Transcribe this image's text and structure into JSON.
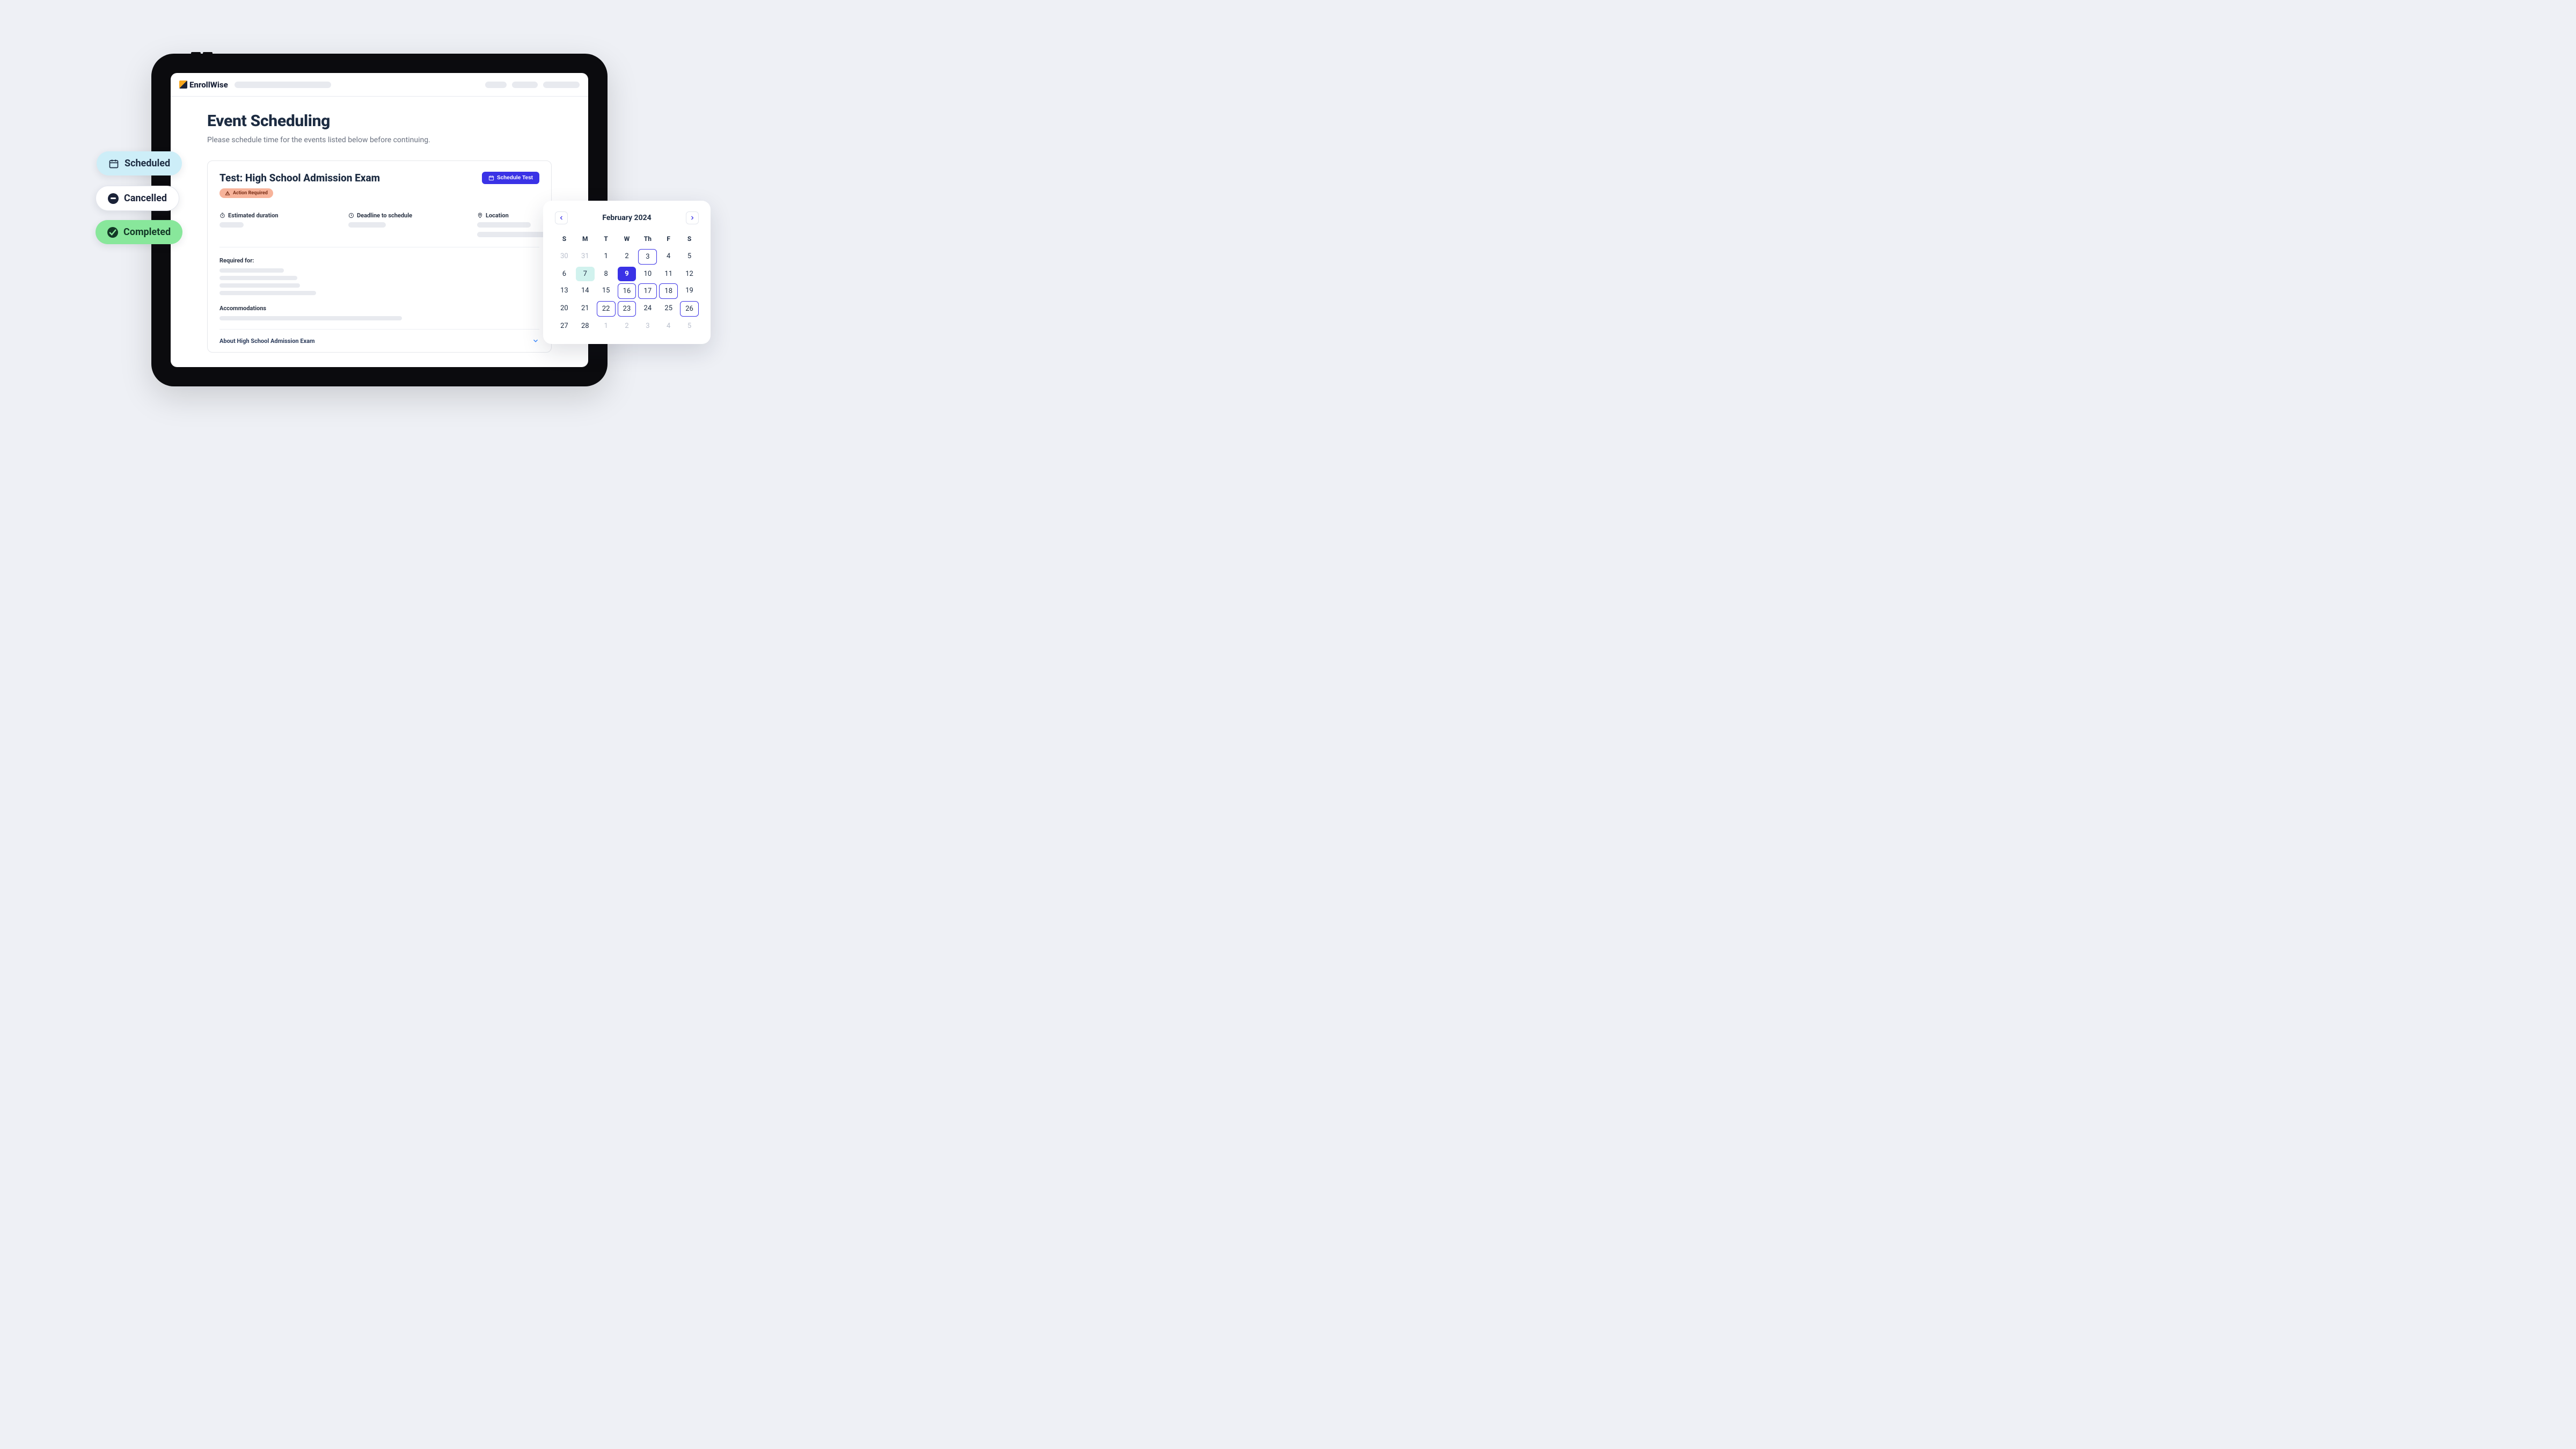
{
  "brand": "EnrollWise",
  "page": {
    "title": "Event Scheduling",
    "subtitle": "Please schedule time for the events listed below before continuing."
  },
  "card": {
    "title": "Test: High School Admission Exam",
    "badge": "Action Required",
    "schedule_button": "Schedule Test",
    "meta": {
      "duration_label": "Estimated duration",
      "deadline_label": "Deadline to schedule",
      "location_label": "Location"
    },
    "section_required": "Required for:",
    "section_accommodations": "Accommodations",
    "about_label": "About High School Admission Exam"
  },
  "status_pills": {
    "scheduled": "Scheduled",
    "cancelled": "Cancelled",
    "completed": "Completed"
  },
  "calendar": {
    "month_label": "February 2024",
    "dow": [
      "S",
      "M",
      "T",
      "W",
      "Th",
      "F",
      "S"
    ],
    "prev_trail": [
      30,
      31
    ],
    "days": [
      1,
      2,
      3,
      4,
      5,
      6,
      7,
      8,
      9,
      10,
      11,
      12,
      13,
      14,
      15,
      16,
      17,
      18,
      19,
      20,
      21,
      22,
      23,
      24,
      25,
      26,
      27,
      28
    ],
    "next_trail": [
      1,
      2,
      3,
      4,
      5
    ],
    "available": [
      3,
      16,
      17,
      18,
      22,
      23,
      26
    ],
    "selected": 9,
    "today": 7
  }
}
